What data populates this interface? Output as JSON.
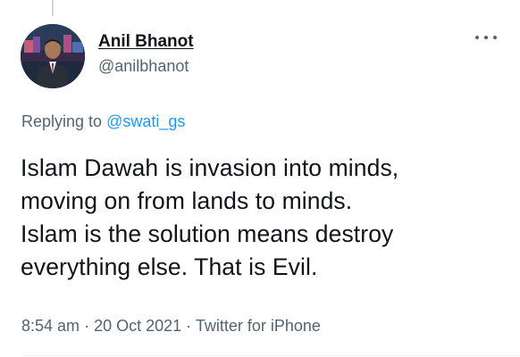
{
  "author": {
    "display_name": "Anil Bhanot",
    "handle": "@anilbhanot",
    "avatar_icon": "profile-photo"
  },
  "reply_context": {
    "prefix": "Replying to",
    "mention": "@swati_gs"
  },
  "tweet": {
    "lines": [
      "Islam Dawah is invasion into minds,",
      "moving on from lands to minds.",
      "Islam is the solution means destroy",
      "everything else. That is Evil."
    ]
  },
  "meta": {
    "time": "8:54 am",
    "separator": "·",
    "date": "20 Oct 2021",
    "source": "Twitter for iPhone"
  },
  "menu": {
    "icon": "more-options-icon"
  },
  "colors": {
    "text": "#0f1419",
    "secondary": "#536471",
    "link": "#1d9bf0"
  }
}
